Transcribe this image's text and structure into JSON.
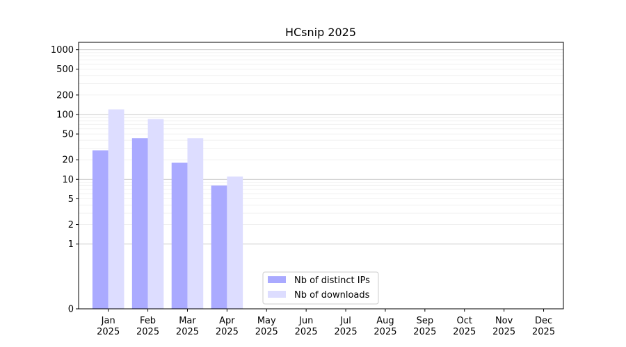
{
  "chart_data": {
    "type": "bar",
    "title": "HCsnip 2025",
    "xlabel": "",
    "ylabel": "",
    "yscale": "symlog",
    "ylim": [
      0,
      1300
    ],
    "categories": [
      [
        "Jan",
        "2025"
      ],
      [
        "Feb",
        "2025"
      ],
      [
        "Mar",
        "2025"
      ],
      [
        "Apr",
        "2025"
      ],
      [
        "May",
        "2025"
      ],
      [
        "Jun",
        "2025"
      ],
      [
        "Jul",
        "2025"
      ],
      [
        "Aug",
        "2025"
      ],
      [
        "Sep",
        "2025"
      ],
      [
        "Oct",
        "2025"
      ],
      [
        "Nov",
        "2025"
      ],
      [
        "Dec",
        "2025"
      ]
    ],
    "y_ticks": [
      0,
      1,
      2,
      5,
      10,
      20,
      50,
      100,
      200,
      500,
      1000
    ],
    "grid": true,
    "legend_position": "lower-center",
    "series": [
      {
        "name": "Nb of distinct IPs",
        "color": "#aaaaff",
        "values": [
          28,
          43,
          18,
          8,
          null,
          null,
          null,
          null,
          null,
          null,
          null,
          null
        ]
      },
      {
        "name": "Nb of downloads",
        "color": "#ddddff",
        "values": [
          120,
          85,
          43,
          11,
          null,
          null,
          null,
          null,
          null,
          null,
          null,
          null
        ]
      }
    ]
  }
}
